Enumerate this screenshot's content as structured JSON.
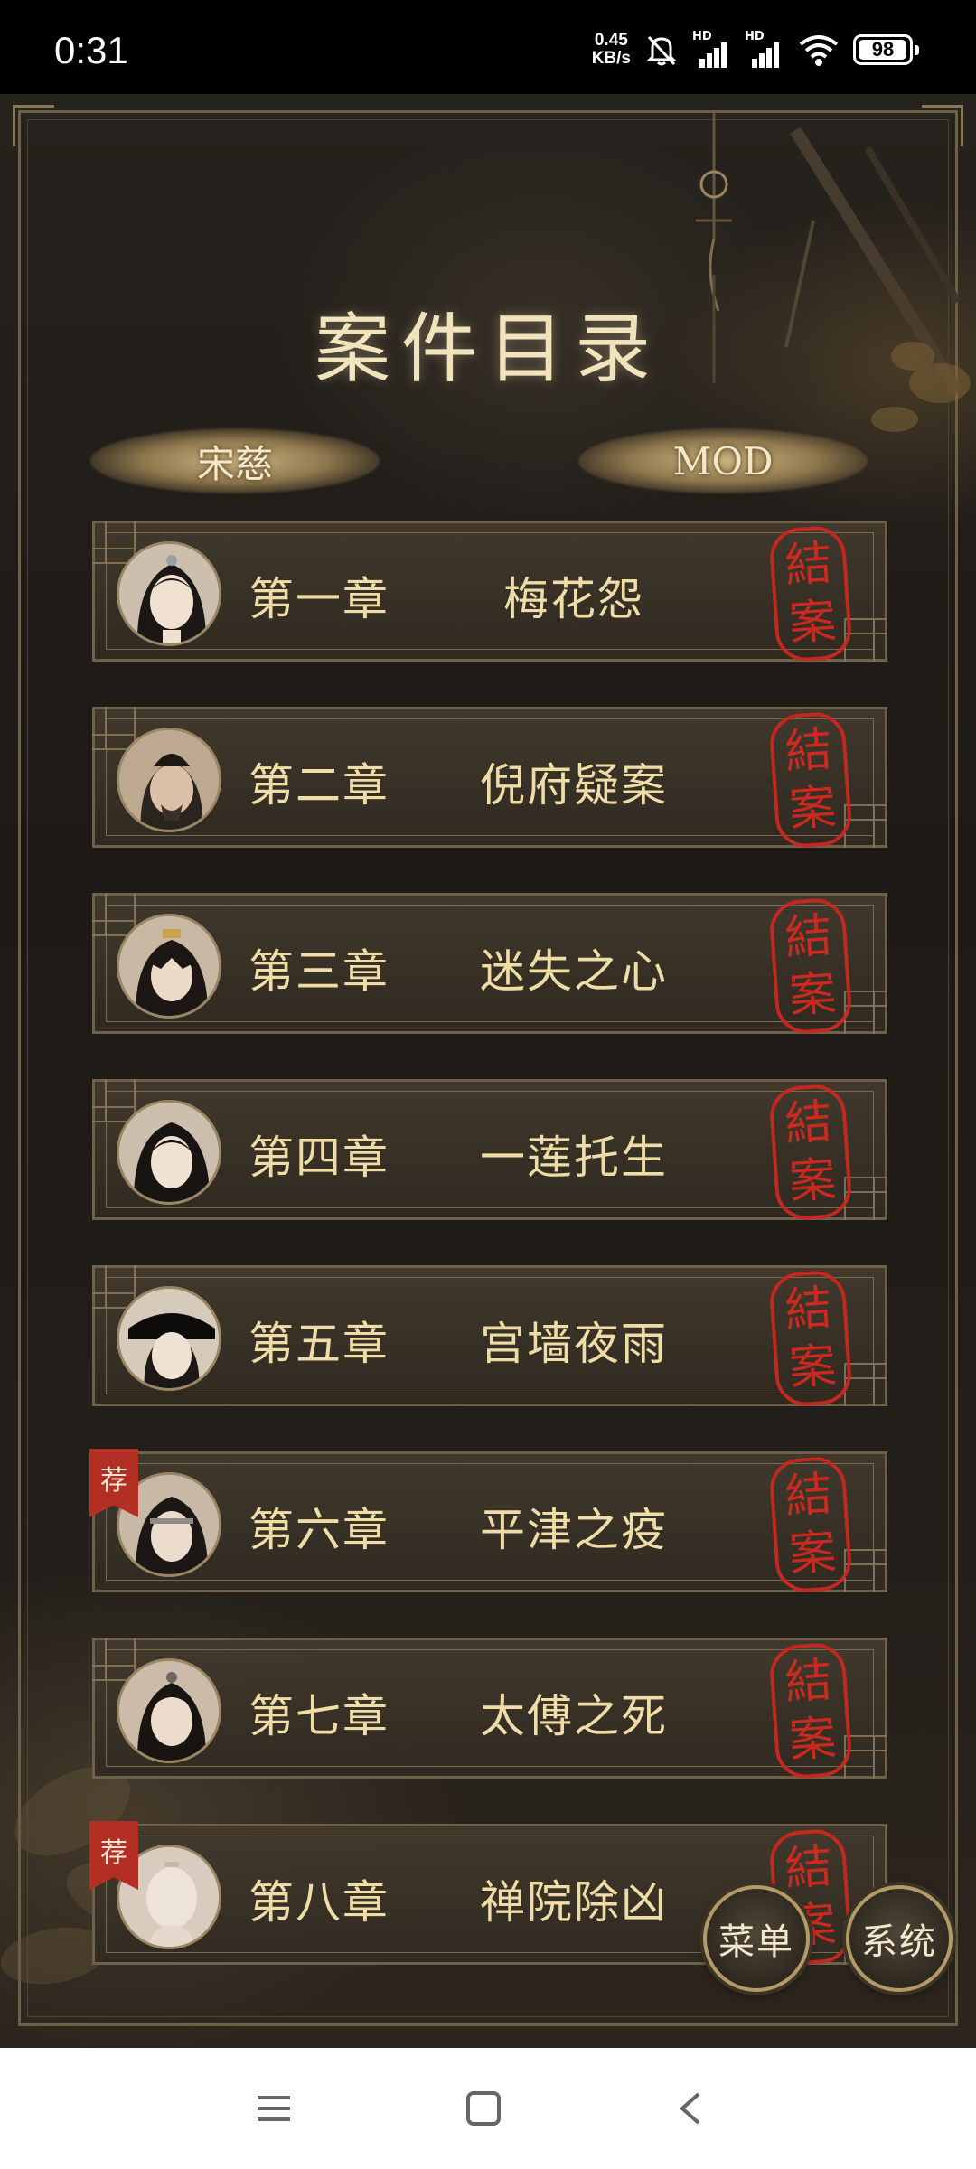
{
  "status_bar": {
    "time": "0:31",
    "speed_value": "0.45",
    "speed_unit": "KB/s",
    "hd1": "HD",
    "hd2": "HD",
    "battery": "98",
    "battery_level_percent": 98
  },
  "page": {
    "title": "案件目录",
    "tabs": [
      {
        "label": "宋慈"
      },
      {
        "label": "MOD"
      }
    ]
  },
  "chapters": [
    {
      "number": "第一章",
      "name": "梅花怨",
      "seal": [
        "結",
        "案"
      ],
      "recommended": false
    },
    {
      "number": "第二章",
      "name": "倪府疑案",
      "seal": [
        "結",
        "案"
      ],
      "recommended": false
    },
    {
      "number": "第三章",
      "name": "迷失之心",
      "seal": [
        "結",
        "案"
      ],
      "recommended": false
    },
    {
      "number": "第四章",
      "name": "一莲托生",
      "seal": [
        "結",
        "案"
      ],
      "recommended": false
    },
    {
      "number": "第五章",
      "name": "宫墙夜雨",
      "seal": [
        "結",
        "案"
      ],
      "recommended": false
    },
    {
      "number": "第六章",
      "name": "平津之疫",
      "seal": [
        "結",
        "案"
      ],
      "recommended": true,
      "flag": "荐"
    },
    {
      "number": "第七章",
      "name": "太傅之死",
      "seal": [
        "結",
        "案"
      ],
      "recommended": false
    },
    {
      "number": "第八章",
      "name": "禅院除凶",
      "seal": [
        "結",
        "案"
      ],
      "recommended": true,
      "flag": "荐"
    }
  ],
  "buttons": {
    "menu": "菜单",
    "system": "系统"
  },
  "colors": {
    "gold_text": "#f0dca6",
    "seal_red": "#d22a20",
    "frame_gold": "#6f6049"
  }
}
